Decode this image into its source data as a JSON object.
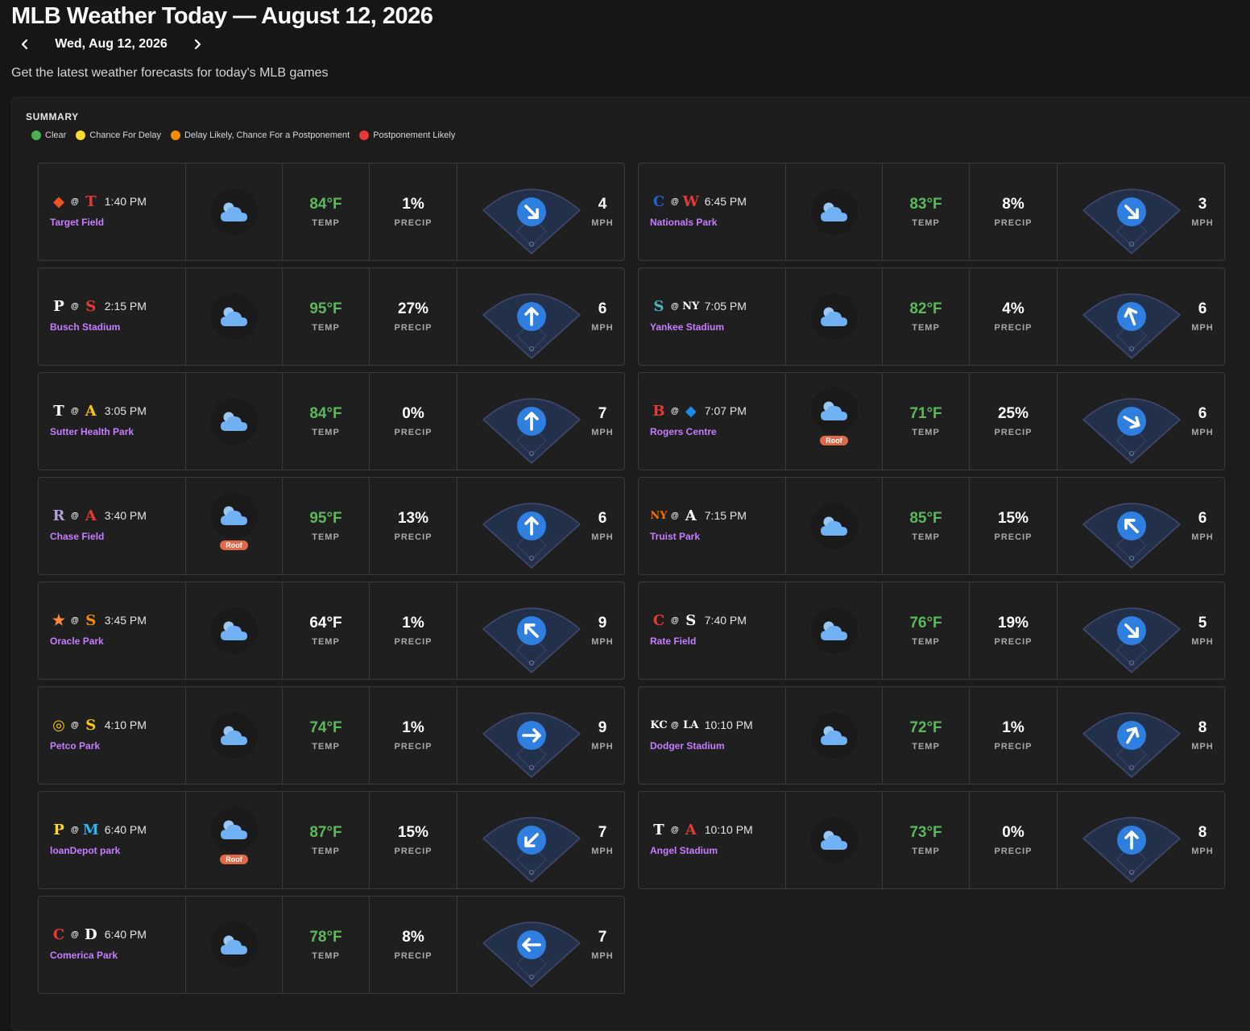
{
  "header": {
    "title": "MLB Weather Today — August 12, 2026",
    "date_label": "Wed, Aug 12, 2026",
    "prev_icon": "chevron-left-icon",
    "next_icon": "chevron-right-icon",
    "subtitle": "Get the latest weather forecasts for today's MLB games"
  },
  "summary": {
    "heading": "SUMMARY",
    "legend": [
      {
        "label": "Clear",
        "color": "#4caf50"
      },
      {
        "label": "Chance For Delay",
        "color": "#fdd835"
      },
      {
        "label": "Delay Likely, Chance For a Postponement",
        "color": "#fb8c00"
      },
      {
        "label": "Postponement Likely",
        "color": "#e53935"
      }
    ]
  },
  "labels": {
    "temp": "TEMP",
    "precip": "PRECIP",
    "wind_unit": "MPH",
    "roof": "Roof"
  },
  "colors": {
    "temp_warm": "#5cb85c",
    "temp_neutral": "#ffffff",
    "venue": "#c77dff",
    "roof_badge": "#e0694a",
    "wind_arrow": "#2f7fe0"
  },
  "games": [
    {
      "away_logo": "orioles-logo",
      "away_color": "#f4511e",
      "away_glyph": "◆",
      "home_logo": "twins-logo",
      "home_color": "#e53935",
      "home_glyph": "T",
      "time": "1:40 PM",
      "venue": "Target Field",
      "weather_icon": "cloud-icon",
      "roof": false,
      "temp": "84°F",
      "temp_color": "#5cb85c",
      "precip": "1%",
      "wind_speed": "4",
      "wind_direction_deg": 135
    },
    {
      "away_logo": "phillies-logo",
      "away_color": "#ffffff",
      "away_glyph": "P",
      "home_logo": "cardinals-logo",
      "home_color": "#e53935",
      "home_glyph": "S",
      "time": "2:15 PM",
      "venue": "Busch Stadium",
      "weather_icon": "cloud-icon",
      "roof": false,
      "temp": "95°F",
      "temp_color": "#5cb85c",
      "precip": "27%",
      "wind_speed": "6",
      "wind_direction_deg": 0
    },
    {
      "away_logo": "rays-logo",
      "away_color": "#ffffff",
      "away_glyph": "T",
      "home_logo": "athletics-logo",
      "home_color": "#f9c80e",
      "home_glyph": "A",
      "time": "3:05 PM",
      "venue": "Sutter Health Park",
      "weather_icon": "cloud-icon",
      "roof": false,
      "temp": "84°F",
      "temp_color": "#5cb85c",
      "precip": "0%",
      "wind_speed": "7",
      "wind_direction_deg": 0
    },
    {
      "away_logo": "rockies-logo",
      "away_color": "#b39ddb",
      "away_glyph": "R",
      "home_logo": "dbacks-logo",
      "home_color": "#e53935",
      "home_glyph": "A",
      "time": "3:40 PM",
      "venue": "Chase Field",
      "weather_icon": "cloud-icon",
      "roof": true,
      "temp": "95°F",
      "temp_color": "#5cb85c",
      "precip": "13%",
      "wind_speed": "6",
      "wind_direction_deg": 0
    },
    {
      "away_logo": "astros-logo",
      "away_color": "#ff8a3d",
      "away_glyph": "★",
      "home_logo": "giants-logo",
      "home_color": "#fb8c00",
      "home_glyph": "S",
      "time": "3:45 PM",
      "venue": "Oracle Park",
      "weather_icon": "cloud-icon",
      "roof": false,
      "temp": "64°F",
      "temp_color": "#ffffff",
      "precip": "1%",
      "wind_speed": "9",
      "wind_direction_deg": 315
    },
    {
      "away_logo": "brewers-logo",
      "away_color": "#f9c80e",
      "away_glyph": "◎",
      "home_logo": "padres-logo",
      "home_color": "#f9c80e",
      "home_glyph": "S",
      "time": "4:10 PM",
      "venue": "Petco Park",
      "weather_icon": "cloud-icon",
      "roof": false,
      "temp": "74°F",
      "temp_color": "#5cb85c",
      "precip": "1%",
      "wind_speed": "9",
      "wind_direction_deg": 90
    },
    {
      "away_logo": "pirates-logo",
      "away_color": "#fdd835",
      "away_glyph": "P",
      "home_logo": "marlins-logo",
      "home_color": "#29b6f6",
      "home_glyph": "M",
      "time": "6:40 PM",
      "venue": "loanDepot park",
      "weather_icon": "cloud-icon",
      "roof": true,
      "temp": "87°F",
      "temp_color": "#5cb85c",
      "precip": "15%",
      "wind_speed": "7",
      "wind_direction_deg": 225
    },
    {
      "away_logo": "guardians-logo",
      "away_color": "#e53935",
      "away_glyph": "C",
      "home_logo": "tigers-logo",
      "home_color": "#ffffff",
      "home_glyph": "D",
      "time": "6:40 PM",
      "venue": "Comerica Park",
      "weather_icon": "cloud-icon",
      "roof": false,
      "temp": "78°F",
      "temp_color": "#5cb85c",
      "precip": "8%",
      "wind_speed": "7",
      "wind_direction_deg": 270
    },
    {
      "away_logo": "cubs-logo",
      "away_color": "#1e63d6",
      "away_glyph": "C",
      "home_logo": "nationals-logo",
      "home_color": "#e53935",
      "home_glyph": "W",
      "time": "6:45 PM",
      "venue": "Nationals Park",
      "weather_icon": "cloud-icon",
      "roof": false,
      "temp": "83°F",
      "temp_color": "#5cb85c",
      "precip": "8%",
      "wind_speed": "3",
      "wind_direction_deg": 135
    },
    {
      "away_logo": "mariners-logo",
      "away_color": "#4fb3bf",
      "away_glyph": "S",
      "home_logo": "yankees-logo",
      "home_color": "#ffffff",
      "home_glyph": "NY",
      "time": "7:05 PM",
      "venue": "Yankee Stadium",
      "weather_icon": "cloud-icon",
      "roof": false,
      "temp": "82°F",
      "temp_color": "#5cb85c",
      "precip": "4%",
      "wind_speed": "6",
      "wind_direction_deg": 340
    },
    {
      "away_logo": "redsox-logo",
      "away_color": "#e53935",
      "away_glyph": "B",
      "home_logo": "bluejays-logo",
      "home_color": "#1e88e5",
      "home_glyph": "◆",
      "time": "7:07 PM",
      "venue": "Rogers Centre",
      "weather_icon": "cloud-icon",
      "roof": true,
      "temp": "71°F",
      "temp_color": "#5cb85c",
      "precip": "25%",
      "wind_speed": "6",
      "wind_direction_deg": 120
    },
    {
      "away_logo": "mets-logo",
      "away_color": "#ff6d00",
      "away_glyph": "NY",
      "home_logo": "braves-logo",
      "home_color": "#ffffff",
      "home_glyph": "A",
      "time": "7:15 PM",
      "venue": "Truist Park",
      "weather_icon": "cloud-icon",
      "roof": false,
      "temp": "85°F",
      "temp_color": "#5cb85c",
      "precip": "15%",
      "wind_speed": "6",
      "wind_direction_deg": 315
    },
    {
      "away_logo": "reds-logo",
      "away_color": "#e53935",
      "away_glyph": "C",
      "home_logo": "whitesox-logo",
      "home_color": "#ffffff",
      "home_glyph": "S",
      "time": "7:40 PM",
      "venue": "Rate Field",
      "weather_icon": "cloud-icon",
      "roof": false,
      "temp": "76°F",
      "temp_color": "#5cb85c",
      "precip": "19%",
      "wind_speed": "5",
      "wind_direction_deg": 135
    },
    {
      "away_logo": "royals-logo",
      "away_color": "#ffffff",
      "away_glyph": "KC",
      "home_logo": "dodgers-logo",
      "home_color": "#ffffff",
      "home_glyph": "LA",
      "time": "10:10 PM",
      "venue": "Dodger Stadium",
      "weather_icon": "cloud-icon",
      "roof": false,
      "temp": "72°F",
      "temp_color": "#5cb85c",
      "precip": "1%",
      "wind_speed": "8",
      "wind_direction_deg": 30
    },
    {
      "away_logo": "rangers-logo",
      "away_color": "#ffffff",
      "away_glyph": "T",
      "home_logo": "angels-logo",
      "home_color": "#e53935",
      "home_glyph": "A",
      "time": "10:10 PM",
      "venue": "Angel Stadium",
      "weather_icon": "cloud-icon",
      "roof": false,
      "temp": "73°F",
      "temp_color": "#5cb85c",
      "precip": "0%",
      "wind_speed": "8",
      "wind_direction_deg": 0
    }
  ]
}
